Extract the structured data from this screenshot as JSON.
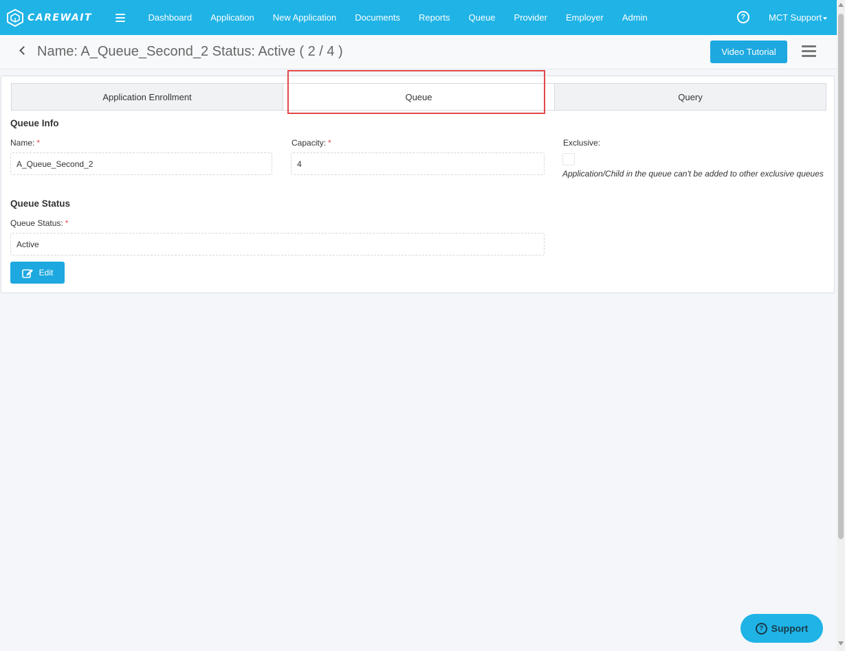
{
  "brand": {
    "name": "CAREWAIT"
  },
  "nav": {
    "items": [
      "Dashboard",
      "Application",
      "New Application",
      "Documents",
      "Reports",
      "Queue",
      "Provider",
      "Employer",
      "Admin"
    ],
    "help_symbol": "?",
    "user": "MCT Support"
  },
  "header": {
    "title": "Name: A_Queue_Second_2 Status: Active ( 2 / 4 )",
    "video_button": "Video Tutorial"
  },
  "tabs": [
    {
      "label": "Application Enrollment",
      "active": false
    },
    {
      "label": "Queue",
      "active": true
    },
    {
      "label": "Query",
      "active": false
    }
  ],
  "queue_info": {
    "section_title": "Queue Info",
    "name_label": "Name:",
    "name_value": "A_Queue_Second_2",
    "capacity_label": "Capacity:",
    "capacity_value": "4",
    "exclusive_label": "Exclusive:",
    "exclusive_checked": false,
    "exclusive_note": "Application/Child in the queue can't be added to other exclusive queues",
    "required_mark": "*"
  },
  "queue_status": {
    "section_title": "Queue Status",
    "status_label": "Queue Status:",
    "status_value": "Active"
  },
  "actions": {
    "edit_label": "Edit"
  },
  "support": {
    "label": "Support",
    "symbol": "?"
  },
  "colors": {
    "primary": "#1fb3e6",
    "button": "#1da8e0",
    "required": "#e04848",
    "highlight": "#e04848"
  },
  "icons": {
    "logo": "carewait-logo-icon",
    "menu": "hamburger-icon",
    "help": "help-circle-icon",
    "back": "chevron-left-icon",
    "options": "menu-lines-icon",
    "edit": "edit-icon",
    "support": "help-circle-icon"
  }
}
